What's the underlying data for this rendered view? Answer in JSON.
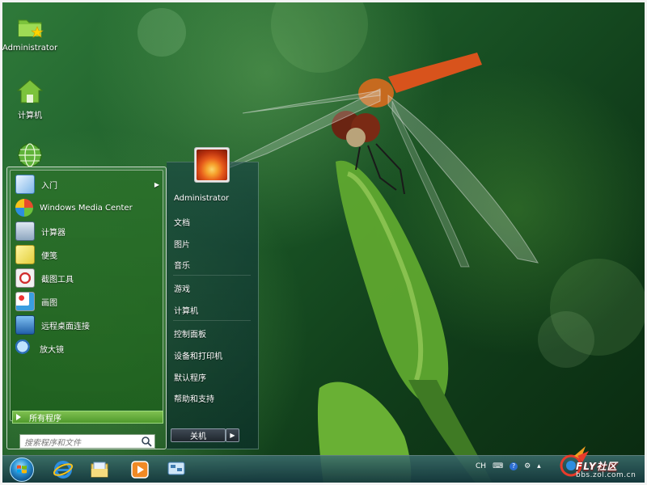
{
  "desktop": {
    "icons": [
      {
        "label": "Administrator",
        "icon": "user-folder-icon"
      },
      {
        "label": "计算机",
        "icon": "computer-icon"
      },
      {
        "label": "",
        "icon": "network-globe-icon"
      }
    ]
  },
  "start_menu": {
    "programs": [
      {
        "label": "入门",
        "icon": "getting-started-icon",
        "has_submenu": true
      },
      {
        "label": "Windows Media Center",
        "icon": "media-center-icon",
        "has_submenu": false
      },
      {
        "label": "计算器",
        "icon": "calculator-icon",
        "has_submenu": false
      },
      {
        "label": "便笺",
        "icon": "sticky-notes-icon",
        "has_submenu": false
      },
      {
        "label": "截图工具",
        "icon": "snipping-tool-icon",
        "has_submenu": false
      },
      {
        "label": "画图",
        "icon": "paint-icon",
        "has_submenu": false
      },
      {
        "label": "远程桌面连接",
        "icon": "remote-desktop-icon",
        "has_submenu": false
      },
      {
        "label": "放大镜",
        "icon": "magnifier-icon",
        "has_submenu": false
      }
    ],
    "all_programs": "所有程序",
    "search_placeholder": "搜索程序和文件",
    "right_items": [
      "Administrator",
      "文档",
      "图片",
      "音乐",
      "游戏",
      "计算机",
      "控制面板",
      "设备和打印机",
      "默认程序",
      "帮助和支持"
    ],
    "shutdown_label": "关机"
  },
  "taskbar": {
    "pinned": [
      "internet-explorer-icon",
      "windows-explorer-icon",
      "media-player-icon",
      "network-icon"
    ],
    "tray": {
      "language": "CH"
    }
  },
  "watermark": {
    "title": "FLY社区",
    "subtitle": "bbs.zol.com.cn"
  }
}
